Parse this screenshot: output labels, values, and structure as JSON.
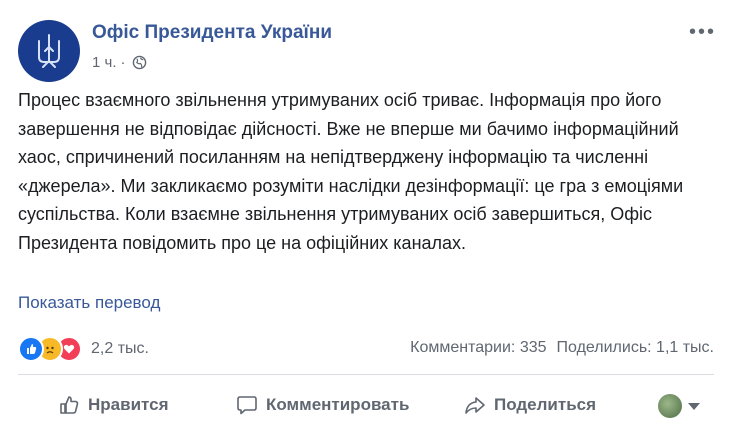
{
  "post": {
    "page_name": "Офіс Президента України",
    "time": "1 ч.",
    "separator": "·",
    "audience_icon": "globe-icon",
    "text": "Процес взаємного звільнення утримуваних осіб триває. Інформація про його завершення не відповідає дійсності. Вже не вперше ми бачимо інформаційний хаос, спричинений посиланням на непідтверджену інформацію та численні «джерела». Ми закликаємо розуміти наслідки дезінформації: це гра з емоціями суспільства. Коли взаємне звільнення утримуваних осіб завершиться, Офіс Президента повідомить про це на офіційних каналах.",
    "translate_link": "Показать перевод"
  },
  "stats": {
    "reactions": [
      "like",
      "sad",
      "love"
    ],
    "reaction_count": "2,2 тыс.",
    "comments": "Комментарии: 335",
    "shares": "Поделились: 1,1 тыс."
  },
  "actions": {
    "like": "Нравится",
    "comment": "Комментировать",
    "share": "Поделиться"
  },
  "colors": {
    "link": "#385898",
    "avatar_bg": "#1a3c8f",
    "like": "#1877f2",
    "sad": "#f7b928",
    "love": "#f33e58"
  }
}
